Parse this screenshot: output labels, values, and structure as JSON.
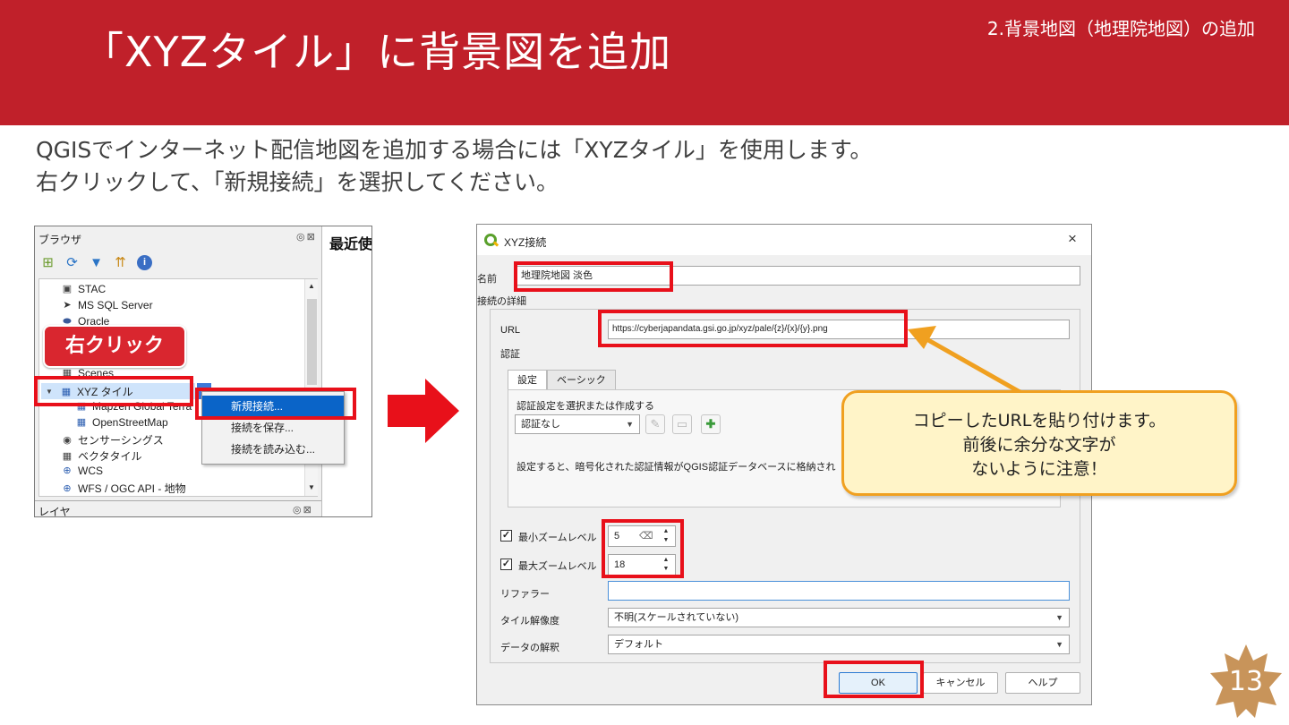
{
  "slide": {
    "title": "「XYZタイル」に背景図を追加",
    "section": "2.背景地図（地理院地図）の追加",
    "intro_line1": "QGISでインターネット配信地図を追加する場合には「XYZタイル」を使用します。",
    "intro_line2": "右クリックして、「新規接続」を選択してください。",
    "page_number": "13",
    "annotation_right_click": "右クリック",
    "callout_line1": "コピーしたURLを貼り付けます。",
    "callout_line2": "前後に余分な文字が",
    "callout_line3": "ないように注意！"
  },
  "browser_panel": {
    "title": "ブラウザ",
    "controls": "◎⊠",
    "recent_label": "最近使",
    "toolbar_icons": [
      "add-layer-icon",
      "refresh-icon",
      "filter-icon",
      "collapse-icon",
      "info-icon"
    ],
    "items": [
      {
        "label": "STAC",
        "icon": "stac-icon"
      },
      {
        "label": "MS SQL Server",
        "icon": "mssql-icon"
      },
      {
        "label": "Oracle",
        "icon": "oracle-icon"
      },
      {
        "label": "Scenes",
        "icon": "scenes-icon"
      },
      {
        "label": "XYZ タイル",
        "icon": "xyz-tiles-icon"
      },
      {
        "label": "Mapzen Global Terra",
        "icon": "tile-grid-icon"
      },
      {
        "label": "OpenStreetMap",
        "icon": "tile-grid-icon"
      },
      {
        "label": "センサーシングス",
        "icon": "sensor-icon"
      },
      {
        "label": "ベクタタイル",
        "icon": "vector-tile-icon"
      },
      {
        "label": "WCS",
        "icon": "wcs-icon"
      },
      {
        "label": "WFS / OGC API - 地物",
        "icon": "wfs-icon"
      }
    ],
    "layer_panel_title": "レイヤ",
    "context_menu": [
      "新規接続...",
      "接続を保存...",
      "接続を読み込む..."
    ]
  },
  "dialog": {
    "title": "XYZ接続",
    "close": "×",
    "name_label": "名前",
    "name_value": "地理院地図 淡色",
    "details_label": "接続の詳細",
    "url_label": "URL",
    "url_value": "https://cyberjapandata.gsi.go.jp/xyz/pale/{z}/{x}/{y}.png",
    "auth_label": "認証",
    "tabs": [
      "設定",
      "ベーシック"
    ],
    "auth_select_label": "認証設定を選択または作成する",
    "auth_none": "認証なし",
    "auth_note": "設定すると、暗号化された認証情報がQGIS認証データベースに格納され",
    "min_zoom_label": "最小ズームレベル",
    "min_zoom_value": "5",
    "max_zoom_label": "最大ズームレベル",
    "max_zoom_value": "18",
    "referer_label": "リファラー",
    "referer_value": "",
    "resolution_label": "タイル解像度",
    "resolution_value": "不明(スケールされていない)",
    "interpretation_label": "データの解釈",
    "interpretation_value": "デフォルト",
    "ok": "OK",
    "cancel": "キャンセル",
    "help": "ヘルプ"
  },
  "colors": {
    "header": "#c0202a",
    "highlight_box": "#e8101a",
    "callout_fill": "#fff4c8",
    "callout_border": "#f0a020",
    "menu_highlight": "#0a64c8"
  }
}
